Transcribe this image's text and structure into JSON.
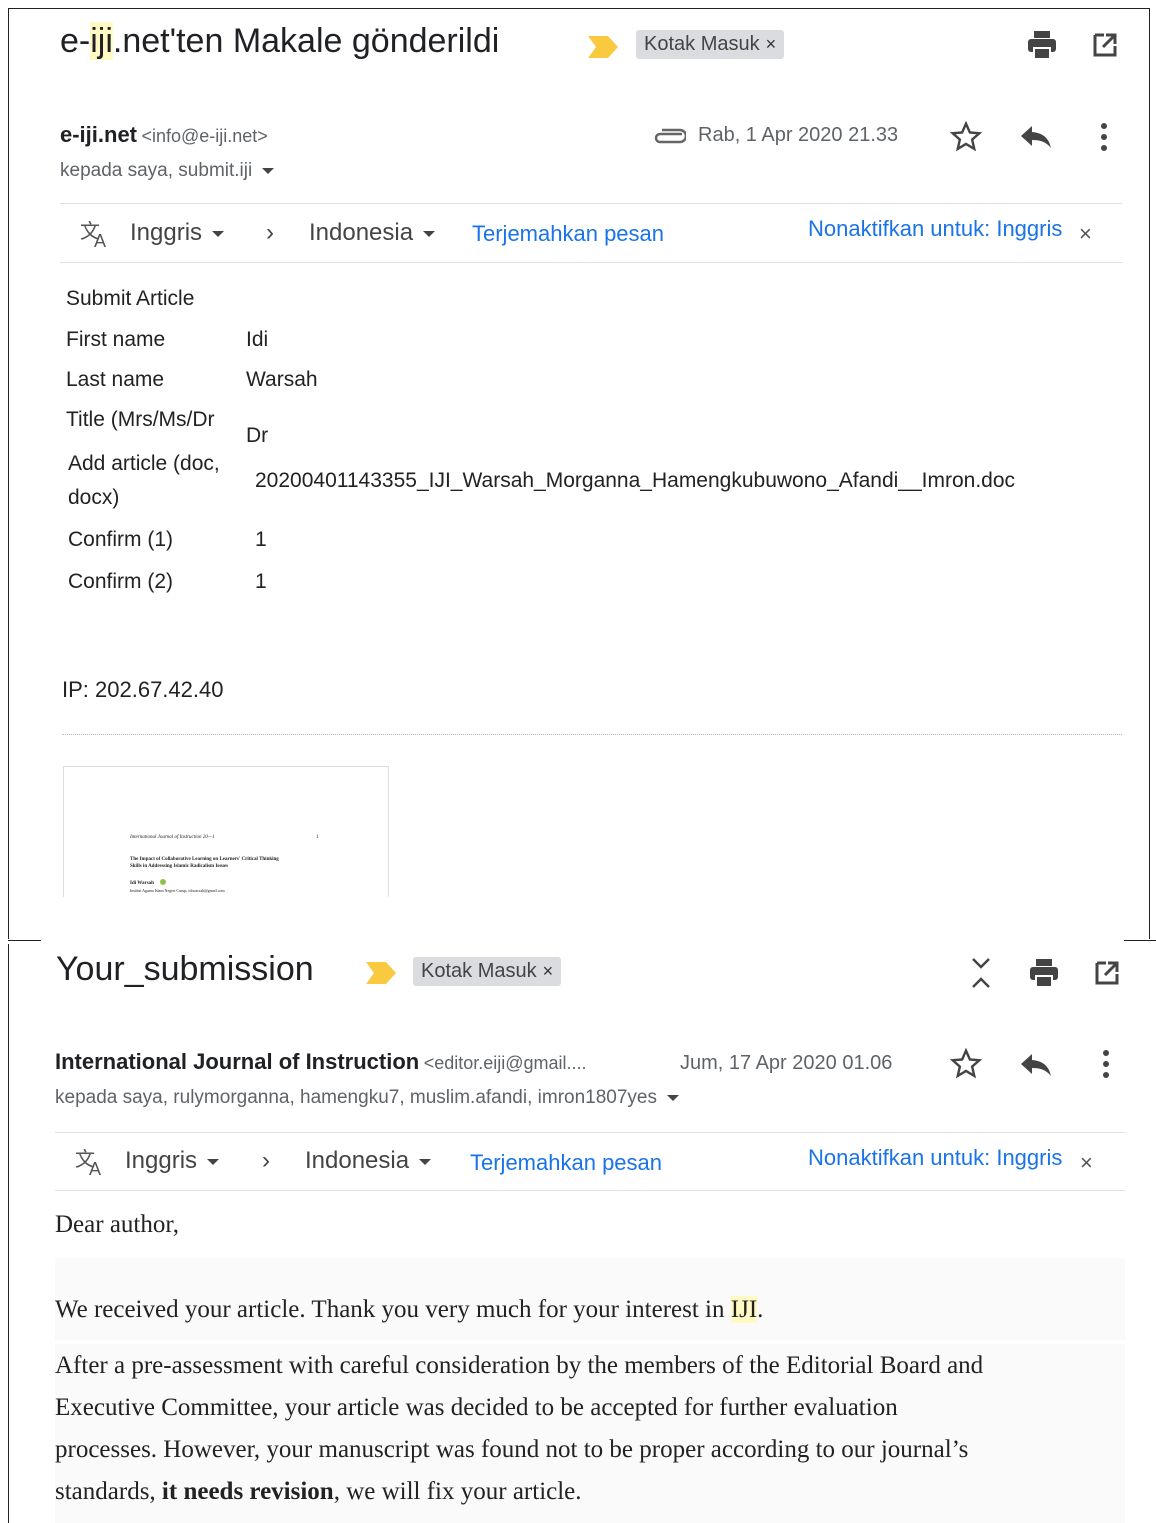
{
  "email1": {
    "subject_pre": "e-",
    "subject_hl": "iji",
    "subject_post": ".net'ten Makale gönderildi",
    "label": "Kotak Masuk",
    "sender_name": "e-iji.net",
    "sender_email": "<info@e-iji.net>",
    "date": "Rab, 1 Apr 2020 21.33",
    "recipients": "kepada saya, submit.iji",
    "translate": {
      "from": "Inggris",
      "to": "Indonesia",
      "action": "Terjemahkan pesan",
      "disable": "Nonaktifkan untuk: Inggris"
    },
    "form_title": "Submit Article",
    "fields": [
      {
        "label": "First name",
        "value": "Idi"
      },
      {
        "label": "Last name",
        "value": "Warsah"
      },
      {
        "label": "Title (Mrs/Ms/Dr",
        "value": "Dr"
      },
      {
        "label": "Add article (doc,",
        "label2": "docx)",
        "value": "20200401143355_IJI_Warsah_Morganna_Hamengkubuwono_Afandi__Imron.doc"
      },
      {
        "label": "Confirm (1)",
        "value": "1"
      },
      {
        "label": "Confirm (2)",
        "value": "1"
      }
    ],
    "ip": "IP: 202.67.42.40",
    "attachment": {
      "line1": "International Journal of Instruction 20—1",
      "line1b": "1",
      "line2": "The Impact of Collaborative Learning on Learners' Critical Thinking",
      "line3": "Skills in Addressing Islamic Radicalism Issues",
      "line4": "Idi Warsah",
      "line5": "Institut Agama Islam Negeri Curup, idiwarsah@gmail.com"
    }
  },
  "email2": {
    "subject": "Your_submission",
    "label": "Kotak Masuk",
    "sender_name": "International Journal of Instruction",
    "sender_email": "<editor.eiji@gmail....",
    "date": "Jum, 17 Apr 2020 01.06",
    "recipients": "kepada saya, rulymorganna, hamengku7, muslim.afandi, imron1807yes",
    "translate": {
      "from": "Inggris",
      "to": "Indonesia",
      "action": "Terjemahkan pesan",
      "disable": "Nonaktifkan untuk: Inggris"
    },
    "greeting": "Dear author,",
    "p1_pre": "We received your article. Thank you very much for your interest in ",
    "p1_hl": "IJI",
    "p1_post": ".",
    "p2_l1": "After a pre-assessment with careful consideration by the members of the Editorial Board and",
    "p2_l2": "Executive Committee, your article was decided to be accepted for further evaluation",
    "p2_l3": "processes. However, your manuscript was found not to be proper according to our journal’s",
    "p2_l4_pre": "standards, ",
    "p2_l4_bold": "it needs revision",
    "p2_l4_post": ", we will fix your article."
  },
  "colors": {
    "link": "#1a73e8",
    "important_marker": "#f9c940",
    "highlight": "#fff9c4",
    "chip": "#dadce0"
  }
}
